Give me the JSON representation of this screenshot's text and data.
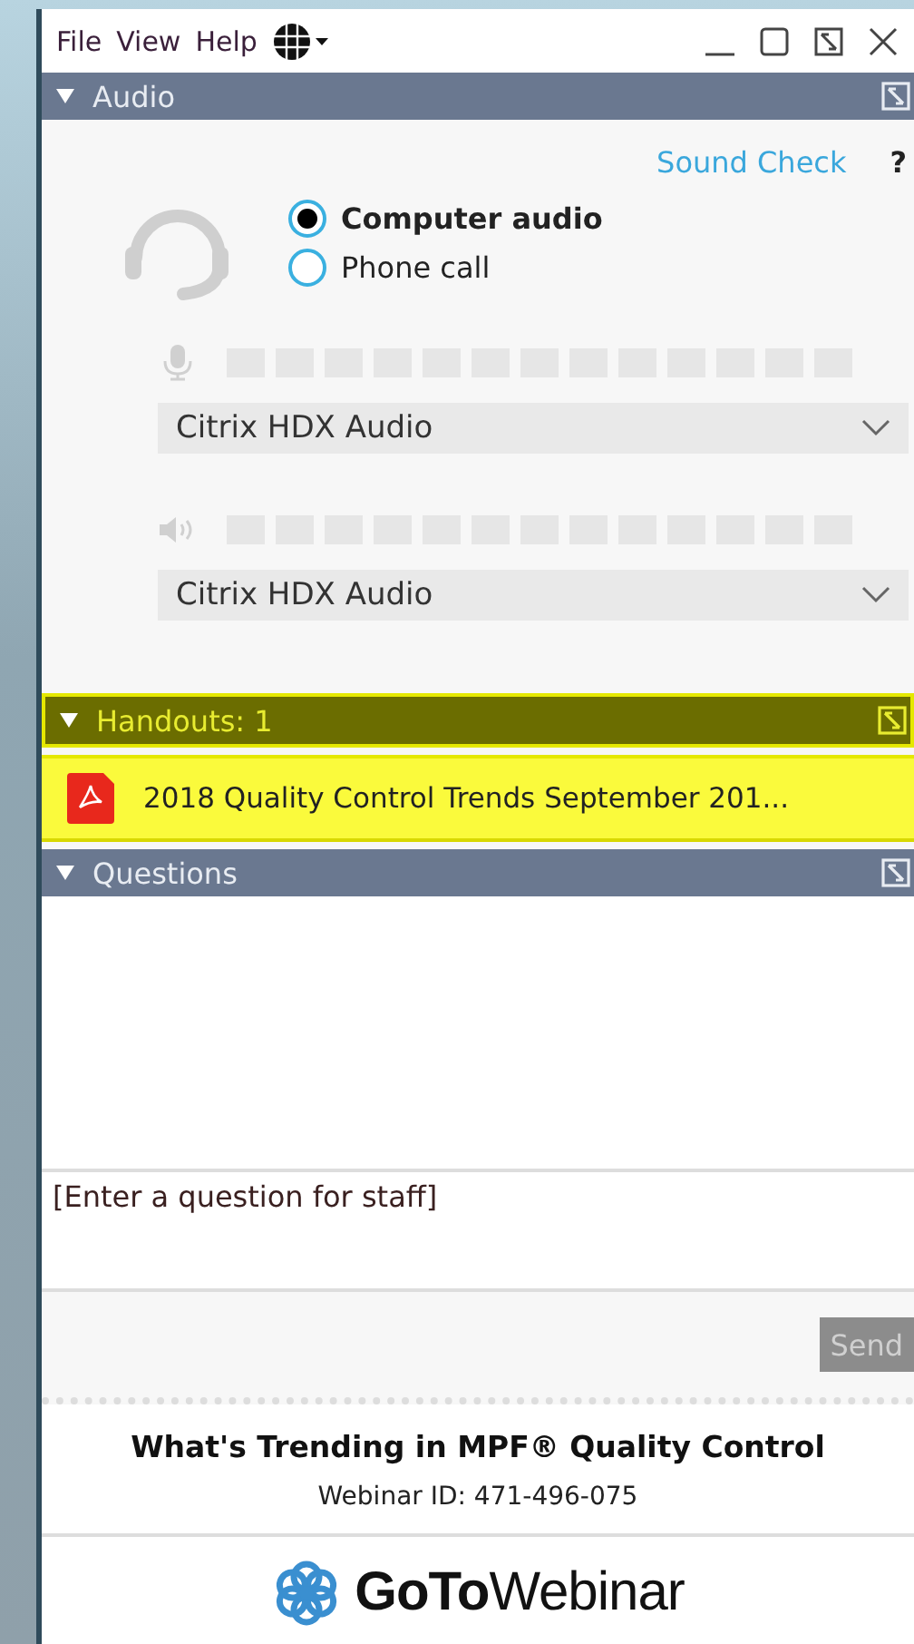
{
  "menu": [
    "File",
    "View",
    "Help"
  ],
  "audio": {
    "title": "Audio",
    "expanded": true,
    "sound_check": "Sound Check",
    "help": "?",
    "options": [
      {
        "label": "Computer audio",
        "selected": true
      },
      {
        "label": "Phone call",
        "selected": false
      }
    ],
    "devices": [
      {
        "kind": "microphone",
        "value": "Citrix HDX Audio"
      },
      {
        "kind": "speaker",
        "value": "Citrix HDX Audio"
      }
    ]
  },
  "handouts": {
    "title": "Handouts: 1",
    "expanded": true,
    "highlighted": true,
    "items": [
      {
        "name": "2018 Quality Control Trends September 201..."
      }
    ]
  },
  "questions": {
    "title": "Questions",
    "expanded": true,
    "placeholder": "[Enter a question for staff]",
    "send": "Send",
    "send_disabled": true
  },
  "footer": {
    "title": "What's Trending in MPF® Quality Control",
    "webinar_id": "Webinar ID: 471-496-075",
    "logo": "**GoTo**Webinar"
  }
}
